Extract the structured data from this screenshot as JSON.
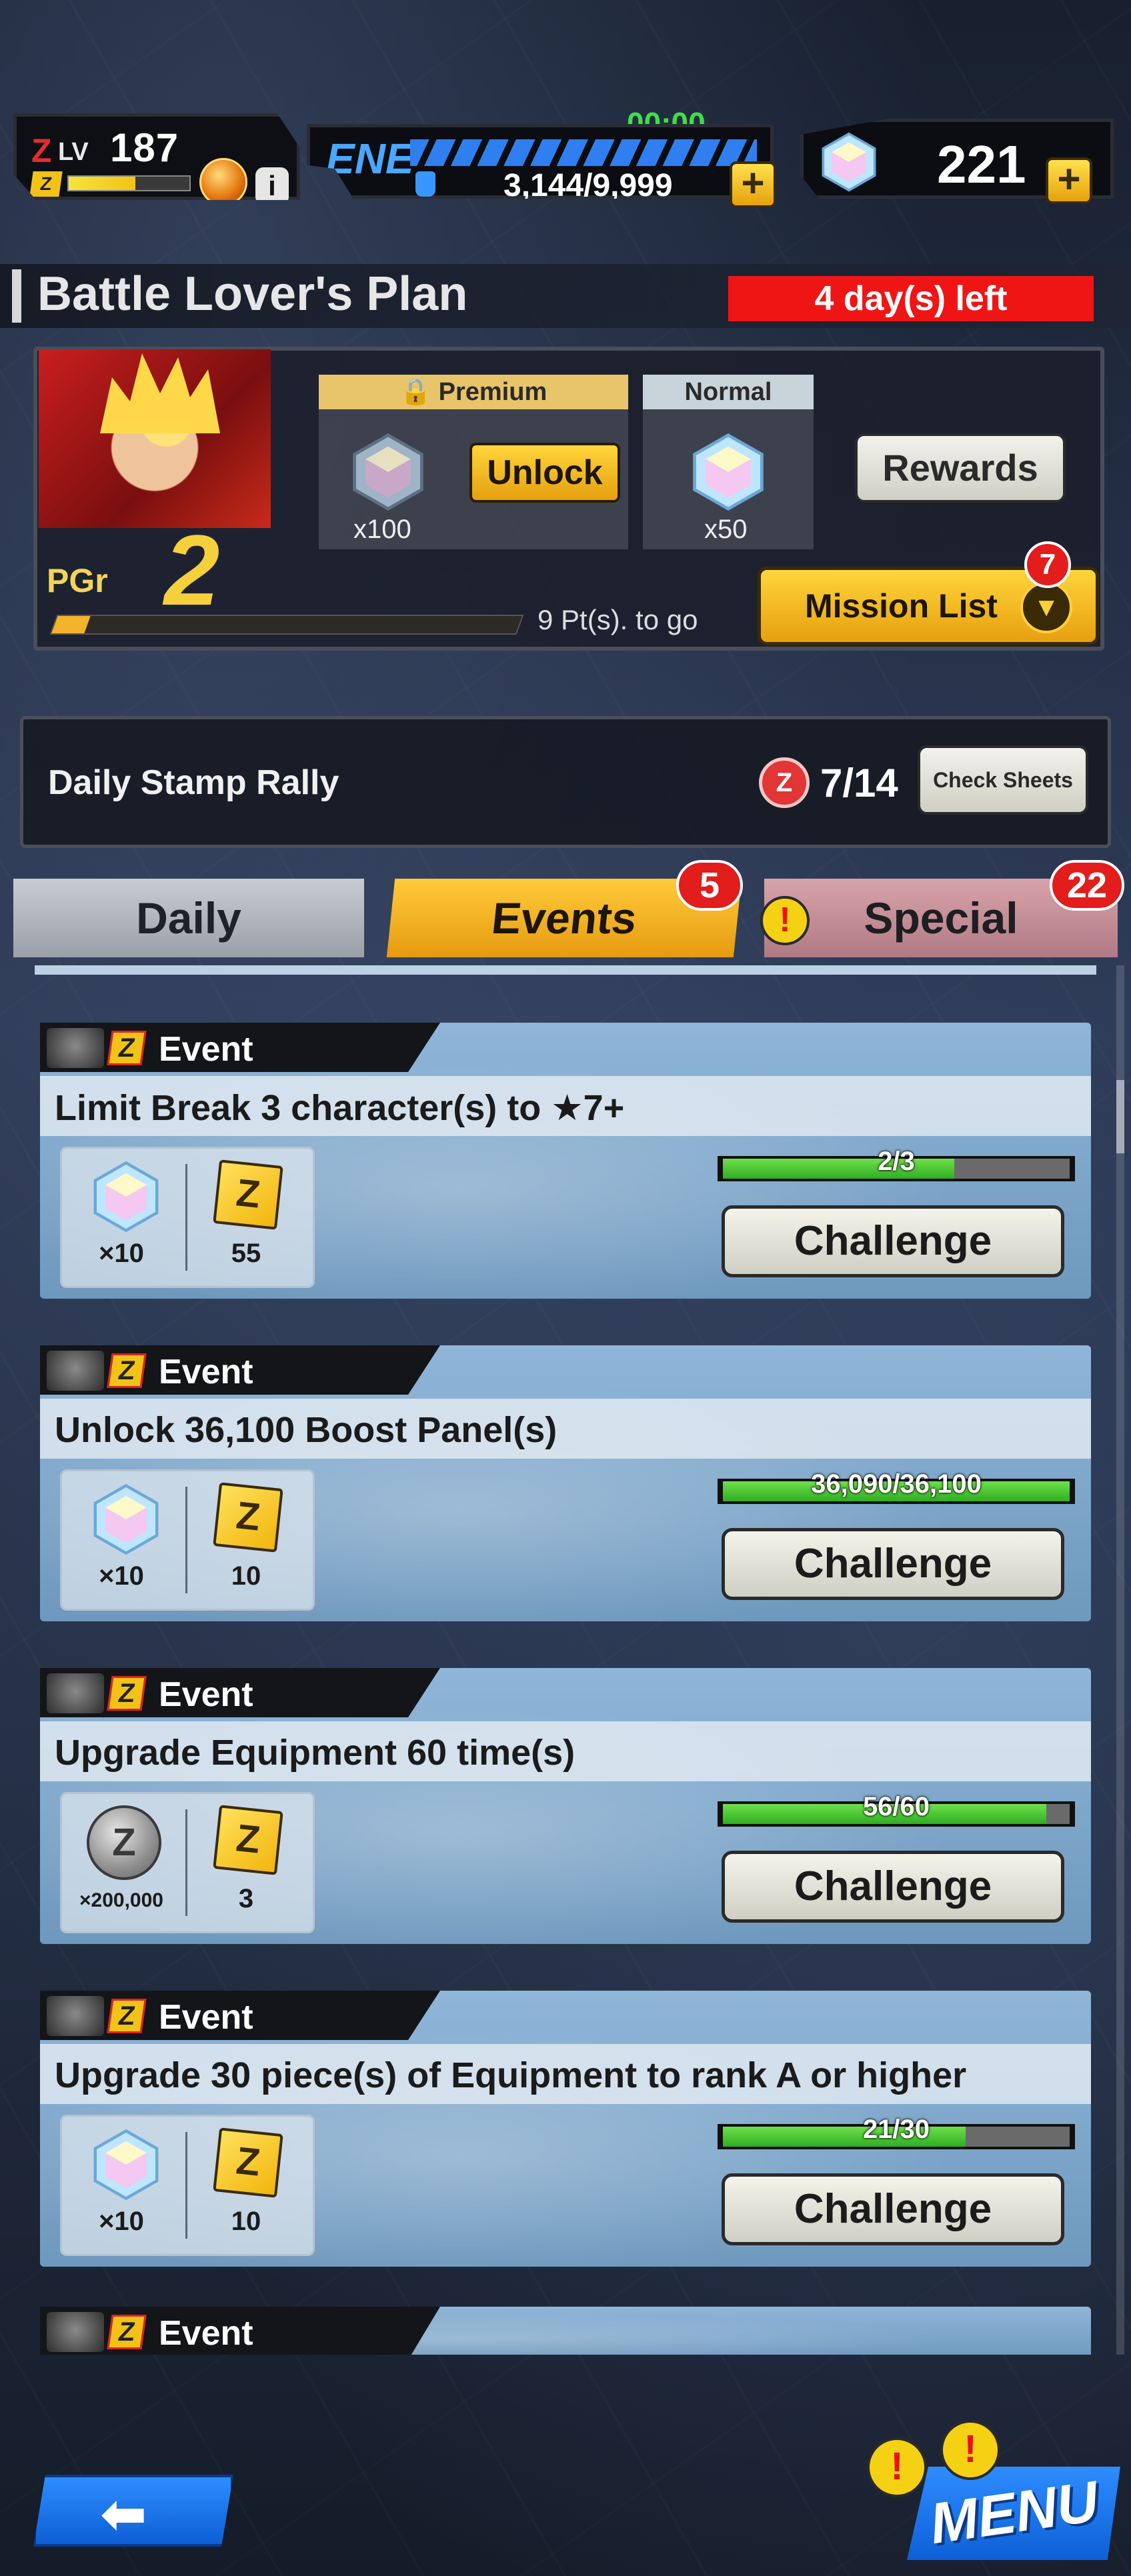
{
  "status": {
    "level_prefix": "Z",
    "level_label": "LV",
    "level": "187",
    "level_progress": 0.55,
    "level_badge": "Z",
    "info_label": "i",
    "timer": "00:00",
    "energy_label": "ENE",
    "energy": "3,144/9,999",
    "crystals": "221",
    "plus_label": "+"
  },
  "plan": {
    "title": "Battle Lover's Plan",
    "days_left": "4 day(s) left",
    "pgr_label": "PGr",
    "pgr_level": "2",
    "pgr_progress": 0.07,
    "pts_to_go": "9 Pt(s). to go",
    "premium_label": "Premium",
    "premium_qty": "x100",
    "unlock_label": "Unlock",
    "normal_label": "Normal",
    "normal_qty": "x50",
    "rewards_label": "Rewards",
    "mission_list_label": "Mission List",
    "mission_list_badge": "7",
    "arrow_label": "▼"
  },
  "stamp_rally": {
    "title": "Daily Stamp Rally",
    "icon_label": "Z",
    "count": "7/14",
    "check_label": "Check Sheets"
  },
  "tabs": {
    "daily": "Daily",
    "events": "Events",
    "events_badge": "5",
    "special": "Special",
    "special_badge": "22",
    "alert_label": "!"
  },
  "missions": [
    {
      "tag": "Event",
      "title": "Limit Break 3 character(s) to ★7+",
      "reward1_qty": "×10",
      "reward2_qty": "55",
      "progress_text": "2/3",
      "progress": 0.667,
      "button": "Challenge"
    },
    {
      "tag": "Event",
      "title": "Unlock 36,100 Boost Panel(s)",
      "reward1_qty": "×10",
      "reward2_qty": "10",
      "progress_text": "36,090/36,100",
      "progress": 0.9997,
      "button": "Challenge"
    },
    {
      "tag": "Event",
      "title": "Upgrade Equipment 60 time(s)",
      "reward1_qty": "×200,000",
      "reward2_qty": "3",
      "progress_text": "56/60",
      "progress": 0.933,
      "button": "Challenge"
    },
    {
      "tag": "Event",
      "title": "Upgrade 30 piece(s) of Equipment to rank A or higher",
      "reward1_qty": "×10",
      "reward2_qty": "10",
      "progress_text": "21/30",
      "progress": 0.7,
      "button": "Challenge"
    }
  ],
  "partial_mission_tag": "Event",
  "nav": {
    "back_label": "⬅",
    "menu_label": "MENU",
    "alert_label": "!"
  },
  "colors": {
    "accent_gold": "#e6a010",
    "progress_green": "#2fae22",
    "alert_red": "#e31c1c",
    "energy_blue": "#2f7ff0"
  }
}
